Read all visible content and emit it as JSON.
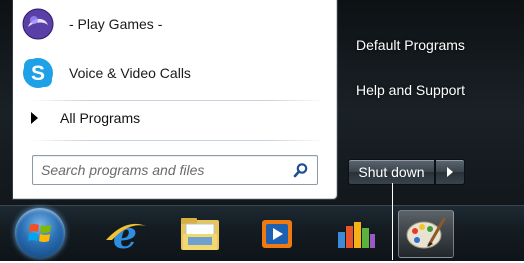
{
  "left_pane": {
    "items": [
      {
        "label": "- Play Games -",
        "icon": "games-icon"
      },
      {
        "label": "Voice & Video Calls",
        "icon": "skype-icon"
      }
    ],
    "all_programs": "All Programs",
    "search": {
      "placeholder": "Search programs and files",
      "value": ""
    }
  },
  "right_pane": {
    "links": [
      "Default Programs",
      "Help and Support"
    ],
    "shutdown_label": "Shut down"
  },
  "taskbar": {
    "buttons": [
      "start-orb",
      "internet-explorer-icon",
      "file-explorer-icon",
      "media-player-icon",
      "windows-live-icon",
      "paint-icon"
    ],
    "active": "paint-icon"
  },
  "colors": {
    "accent": "#2a6fb4",
    "menu_dark": "#141c22"
  }
}
